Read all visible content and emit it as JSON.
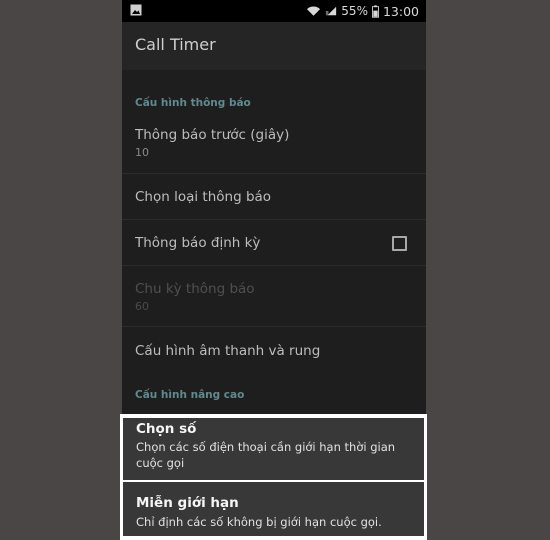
{
  "status_bar": {
    "battery_percent": "55%",
    "time": "13:00",
    "icons": [
      "image-icon",
      "wifi-icon",
      "signal-icon",
      "battery-icon"
    ]
  },
  "app_bar": {
    "title": "Call Timer"
  },
  "sections": {
    "notification": {
      "header": "Cấu hình thông báo"
    },
    "advanced": {
      "header": "Cấu hình nâng cao"
    }
  },
  "prefs": {
    "notify_before": {
      "title": "Thông báo trước (giây)",
      "summary": "10"
    },
    "notify_type": {
      "title": "Chọn loại thông báo"
    },
    "periodic": {
      "title": "Thông báo định kỳ",
      "checked": false
    },
    "period": {
      "title": "Chu kỳ thông báo",
      "summary": "60"
    },
    "sound_vibrate": {
      "title": "Cấu hình âm thanh và rung"
    },
    "choose_number": {
      "title": "Chọn số",
      "summary": "Chọn các số điện thoại cần giới hạn thời gian cuộc gọi"
    },
    "unlimited": {
      "title": "Miễn giới hạn",
      "summary": "Chỉ định các số không bị giới hạn cuộc gọi."
    }
  },
  "colors": {
    "background": "#4a4646",
    "screen": "#1f1e1e",
    "section_header": "#5f8a8f",
    "highlight_border": "#ffffff"
  }
}
